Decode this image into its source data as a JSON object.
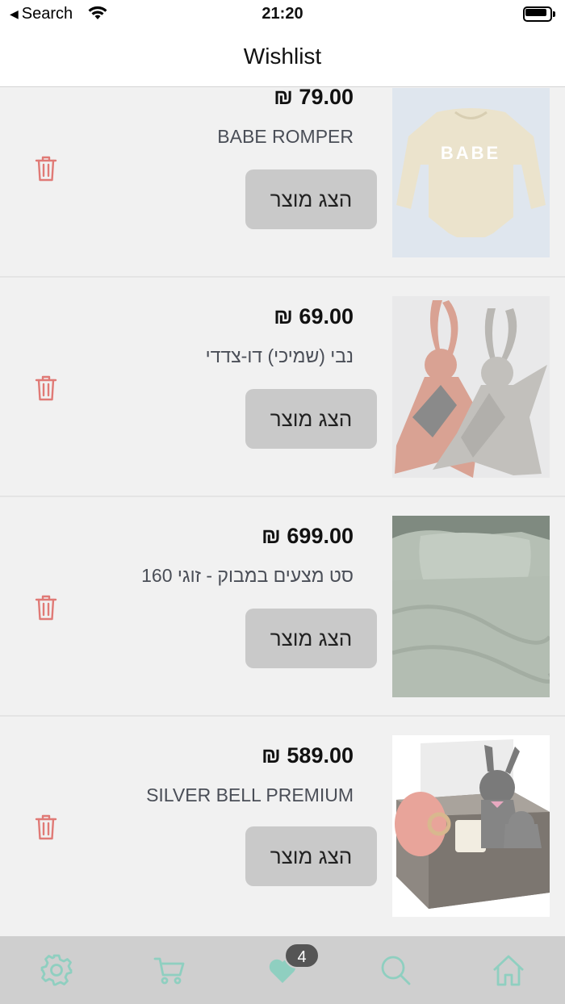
{
  "status_bar": {
    "back_label": "Search",
    "time": "21:20"
  },
  "header": {
    "title": "Wishlist"
  },
  "items": [
    {
      "price": "₪ 79.00",
      "name": "BABE ROMPER",
      "button_label": "הצג מוצר"
    },
    {
      "price": "₪ 69.00",
      "name": "נבי (שמיכי) דו-צדדי",
      "button_label": "הצג מוצר"
    },
    {
      "price": "₪ 699.00",
      "name": "סט מצעים במבוק - זוגי 160",
      "button_label": "הצג מוצר"
    },
    {
      "price": "₪ 589.00",
      "name": "SILVER BELL PREMIUM",
      "button_label": "הצג מוצר"
    }
  ],
  "tabbar": {
    "wishlist_count": "4",
    "icons": [
      "gear-icon",
      "cart-icon",
      "heart-icon",
      "search-icon",
      "home-icon"
    ]
  },
  "colors": {
    "accent": "#8fcfc0",
    "trash": "#e07a76",
    "button_bg": "#c9c9c9",
    "tabbar_bg": "#cfcfcf",
    "badge_bg": "#555555"
  }
}
